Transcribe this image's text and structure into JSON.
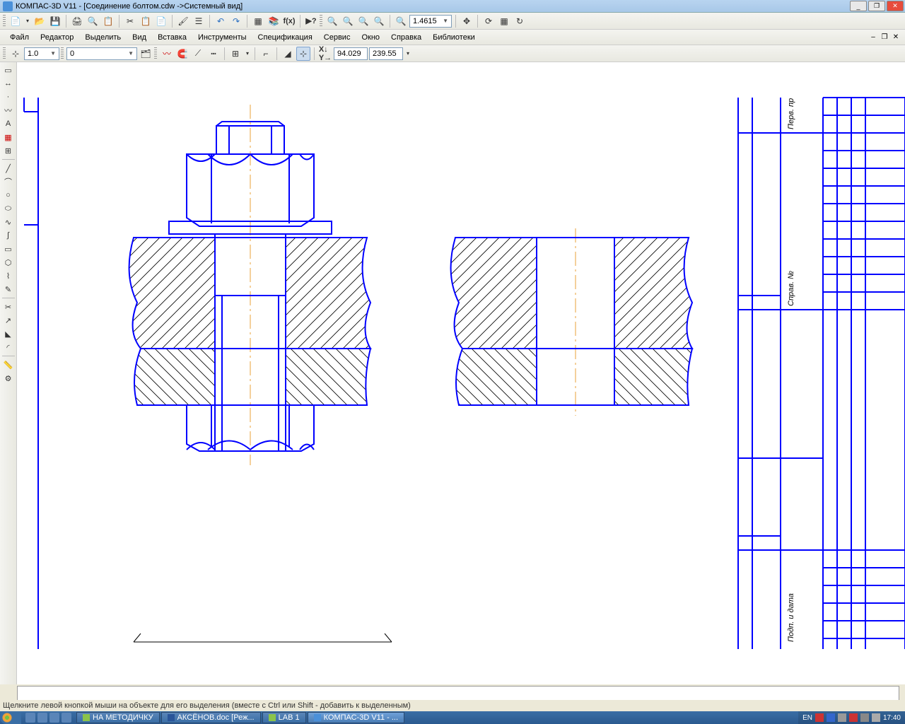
{
  "window": {
    "title": "КОМПАС-3D V11 - [Соединение болтом.cdw ->Системный вид]"
  },
  "menu": {
    "file": "Файл",
    "editor": "Редактор",
    "select": "Выделить",
    "view": "Вид",
    "insert": "Вставка",
    "tools": "Инструменты",
    "spec": "Спецификация",
    "service": "Сервис",
    "window": "Окно",
    "help": "Справка",
    "libs": "Библиотеки"
  },
  "toolbar1": {
    "zoom_value": "1.4615"
  },
  "toolbar3": {
    "scale_value": "1.0",
    "layer_value": "0",
    "coord_x": "94.029",
    "coord_y": "239.55"
  },
  "status": {
    "text": "Щелкните левой кнопкой мыши на объекте для его выделения (вместе с Ctrl или Shift - добавить к выделенным)"
  },
  "taskbar": {
    "item1": "НА МЕТОДИЧКУ",
    "item2": "АКСЁНОВ.doc [Реж...",
    "item3": "LAB 1",
    "item4": "КОМПАС-3D V11 - ...",
    "lang": "EN",
    "time": "17:40"
  }
}
